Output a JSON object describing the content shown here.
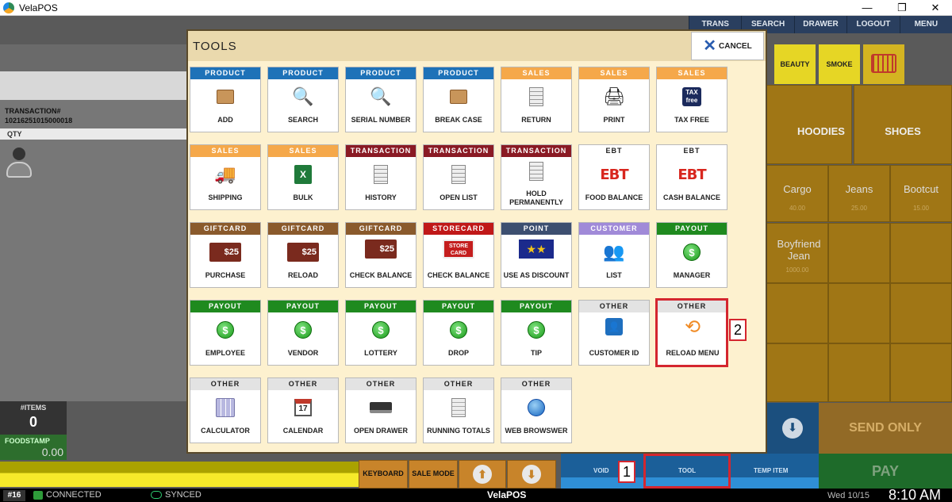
{
  "window": {
    "title": "VelaPOS",
    "controls": [
      "—",
      "❐",
      "✕"
    ]
  },
  "topnav": [
    "TRANS",
    "SEARCH",
    "DRAWER",
    "LOGOUT",
    "MENU"
  ],
  "transaction": {
    "label": "TRANSACTION#",
    "number": "10216251015000018",
    "qty_label": "QTY"
  },
  "items": {
    "label": "#ITEMS",
    "value": "0"
  },
  "foodstamp": {
    "label": "FOODSTAMP",
    "value": "0.00"
  },
  "bottom_buttons": {
    "keyboard": "KEYBOARD",
    "sale_mode": "SALE MODE",
    "void": "VOID",
    "tool": "TOOL",
    "temp_item": "TEMP ITEM",
    "send_only": "SEND ONLY",
    "pay": "PAY"
  },
  "right_tabs": {
    "beauty": "BEAUTY",
    "smoke": "SMOKE"
  },
  "categories": {
    "hoodies": "HOODIES",
    "shoes": "SHOES"
  },
  "products": [
    {
      "name": "Cargo",
      "price": "40.00"
    },
    {
      "name": "Jeans",
      "price": "25.00"
    },
    {
      "name": "Bootcut",
      "price": "15.00"
    },
    {
      "name": "Boyfriend Jean",
      "price": "1000.00"
    }
  ],
  "status": {
    "terminal": "#16",
    "connected": "CONNECTED",
    "synced": "SYNCED",
    "app": "VelaPOS",
    "date": "Wed 10/15",
    "time": "8:10 AM"
  },
  "dialog": {
    "title": "TOOLS",
    "cancel": "CANCEL",
    "tiles": [
      {
        "cat": "PRODUCT",
        "label": "ADD"
      },
      {
        "cat": "PRODUCT",
        "label": "SEARCH"
      },
      {
        "cat": "PRODUCT",
        "label": "SERIAL NUMBER"
      },
      {
        "cat": "PRODUCT",
        "label": "BREAK CASE"
      },
      {
        "cat": "SALES",
        "label": "RETURN"
      },
      {
        "cat": "SALES",
        "label": "PRINT"
      },
      {
        "cat": "SALES",
        "label": "TAX FREE"
      },
      {
        "cat": "SALES",
        "label": "SHIPPING"
      },
      {
        "cat": "SALES",
        "label": "BULK"
      },
      {
        "cat": "TRANSACTION",
        "label": "HISTORY"
      },
      {
        "cat": "TRANSACTION",
        "label": "OPEN LIST"
      },
      {
        "cat": "TRANSACTION",
        "label": "HOLD PERMANENTLY"
      },
      {
        "cat": "EBT",
        "label": "FOOD BALANCE"
      },
      {
        "cat": "EBT",
        "label": "CASH BALANCE"
      },
      {
        "cat": "GIFTCARD",
        "label": "PURCHASE"
      },
      {
        "cat": "GIFTCARD",
        "label": "RELOAD"
      },
      {
        "cat": "GIFTCARD",
        "label": "CHECK BALANCE"
      },
      {
        "cat": "STORECARD",
        "label": "CHECK BALANCE"
      },
      {
        "cat": "POINT",
        "label": "USE AS DISCOUNT"
      },
      {
        "cat": "CUSTOMER",
        "label": "LIST"
      },
      {
        "cat": "PAYOUT",
        "label": "MANAGER"
      },
      {
        "cat": "PAYOUT",
        "label": "EMPLOYEE"
      },
      {
        "cat": "PAYOUT",
        "label": "VENDOR"
      },
      {
        "cat": "PAYOUT",
        "label": "LOTTERY"
      },
      {
        "cat": "PAYOUT",
        "label": "DROP"
      },
      {
        "cat": "PAYOUT",
        "label": "TIP"
      },
      {
        "cat": "OTHER",
        "label": "CUSTOMER ID"
      },
      {
        "cat": "OTHER",
        "label": "RELOAD MENU"
      },
      {
        "cat": "OTHER",
        "label": "CALCULATOR"
      },
      {
        "cat": "OTHER",
        "label": "CALENDAR"
      },
      {
        "cat": "OTHER",
        "label": "OPEN DRAWER"
      },
      {
        "cat": "OTHER",
        "label": "RUNNING TOTALS"
      },
      {
        "cat": "OTHER",
        "label": "WEB BROWSWER"
      }
    ],
    "icon_text": {
      "tax_top": "TAX",
      "tax_bottom": "free",
      "ebt": "EBT",
      "gift": "$25",
      "store": "STORE CARD",
      "dollar": "$",
      "calendar": "17"
    }
  },
  "annotations": {
    "one": "1",
    "two": "2"
  },
  "colors": {
    "product": "#1e72b8",
    "sales": "#f5a84a",
    "transaction": "#8a1a24",
    "giftcard": "#8a5a2c",
    "storecard": "#c01818",
    "point": "#3d4f70",
    "customer": "#a08ad8",
    "payout": "#1f8a1f",
    "other": "#e3e3e3",
    "highlight": "#d4262f"
  }
}
